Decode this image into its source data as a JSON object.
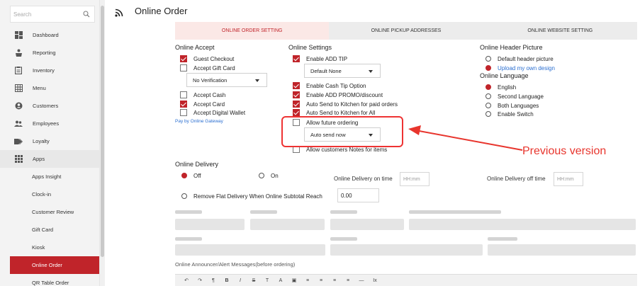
{
  "sidebar": {
    "search_placeholder": "Search",
    "items": [
      {
        "label": "Dashboard",
        "icon": "dashboard-icon"
      },
      {
        "label": "Reporting",
        "icon": "reporting-icon"
      },
      {
        "label": "Inventory",
        "icon": "inventory-icon"
      },
      {
        "label": "Menu",
        "icon": "menu-grid-icon"
      },
      {
        "label": "Customers",
        "icon": "customer-icon"
      },
      {
        "label": "Employees",
        "icon": "employees-icon"
      },
      {
        "label": "Loyalty",
        "icon": "loyalty-tag-icon"
      },
      {
        "label": "Apps",
        "icon": "apps-grid-icon"
      }
    ],
    "sub_items": [
      {
        "label": "Apps Insight"
      },
      {
        "label": "Clock-in"
      },
      {
        "label": "Customer Review"
      },
      {
        "label": "Gift Card"
      },
      {
        "label": "Kiosk"
      },
      {
        "label": "Online Order",
        "active": true
      },
      {
        "label": "QR Table Order"
      }
    ]
  },
  "header": {
    "title": "Online Order"
  },
  "tabs": [
    {
      "label": "ONLINE ORDER SETTING",
      "active": true
    },
    {
      "label": "ONLINE PICKUP ADDRESSES"
    },
    {
      "label": "ONLINE WEBSITE SETTING"
    }
  ],
  "online_accept": {
    "title": "Online Accept",
    "guest_checkout": "Guest Checkout",
    "accept_gift_card": "Accept Gift Card",
    "verification_value": "No Verification",
    "accept_cash": "Accept Cash",
    "accept_card": "Accept Card",
    "accept_wallet": "Accept Digital Wallet",
    "gateway_link": "Pay by Online Gateway"
  },
  "online_settings": {
    "title": "Online Settings",
    "enable_tip": "Enable ADD TIP",
    "tip_default_value": "Default None",
    "cash_tip": "Enable Cash Tip Option",
    "promo": "Enable ADD PROMO/discount",
    "kitchen_paid": "Auto Send to Kitchen for paid orders",
    "kitchen_all": "Auto Send to Kitchen for All",
    "future_ordering": "Allow future ordering",
    "auto_send_value": "Auto send now",
    "notes": "Allow customers Notes for items"
  },
  "header_picture": {
    "title": "Online Header Picture",
    "default": "Default header picture",
    "upload": "Upload my own design"
  },
  "language": {
    "title": "Online Language",
    "english": "English",
    "second": "Second Language",
    "both": "Both Languages",
    "switch": "Enable Switch"
  },
  "annotation": {
    "text": "Previous version"
  },
  "delivery": {
    "title": "Online Delivery",
    "off": "Off",
    "on": "On",
    "on_time_label": "Online Delivery on time",
    "on_time_placeholder": "HH:mm",
    "off_time_label": "Online Delivery off time",
    "off_time_placeholder": "HH:mm",
    "flat_label": "Remove Flat Delivery When Online Subtotal Reach",
    "flat_value": "0.00"
  },
  "footer": {
    "announcement_label": "Online Announcer/Alert Messages(before ordering)"
  },
  "toolbar": {
    "buttons": [
      "↶",
      "↷",
      "¶",
      "B",
      "I",
      "S",
      "T",
      "A",
      "▣",
      "≡",
      "≡",
      "≡",
      "≡",
      "—",
      "Ix"
    ]
  },
  "colors": {
    "accent": "#c0242a",
    "annotation": "#e8352d",
    "link": "#2b6fd1"
  }
}
